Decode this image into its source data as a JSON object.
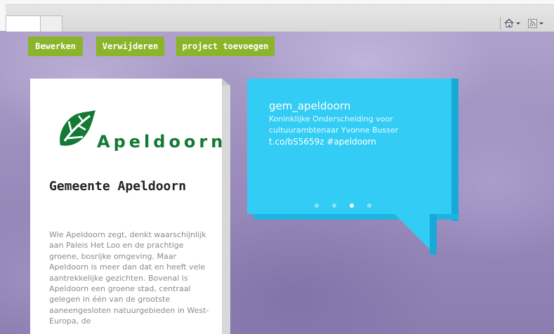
{
  "toolbar": {
    "edit_label": "Bewerken",
    "delete_label": "Verwijderen",
    "add_project_label": "project toevoegen"
  },
  "card": {
    "logo_text": "Apeldoorn",
    "title": "Gemeente Apeldoorn",
    "description": "Wie Apeldoorn zegt, denkt waarschijnlijk aan Paleis Het Loo en de prachtige groene, bosrijke omgeving. Maar Apeldoorn is meer dan dat en heeft vele aantrekkelijke gezichten. Bovenal is Apeldoorn een groene stad, centraal gelegen in één van de grootste aaneengesloten natuurgebieden in West-Europa, de"
  },
  "tweet": {
    "user": "gem_apeldoorn",
    "text": "Koninklijke Onderscheiding voor cultuurambtenaar Yvonne Busser",
    "link": "t.co/bS5659z #apeldoorn",
    "slides": 4,
    "active_slide": 3
  },
  "icons": {
    "home": "home-icon",
    "feed": "rss-feed-icon"
  },
  "colors": {
    "button_green": "#8ab52a",
    "bubble_blue": "#33ccf5",
    "logo_green": "#127a34"
  }
}
